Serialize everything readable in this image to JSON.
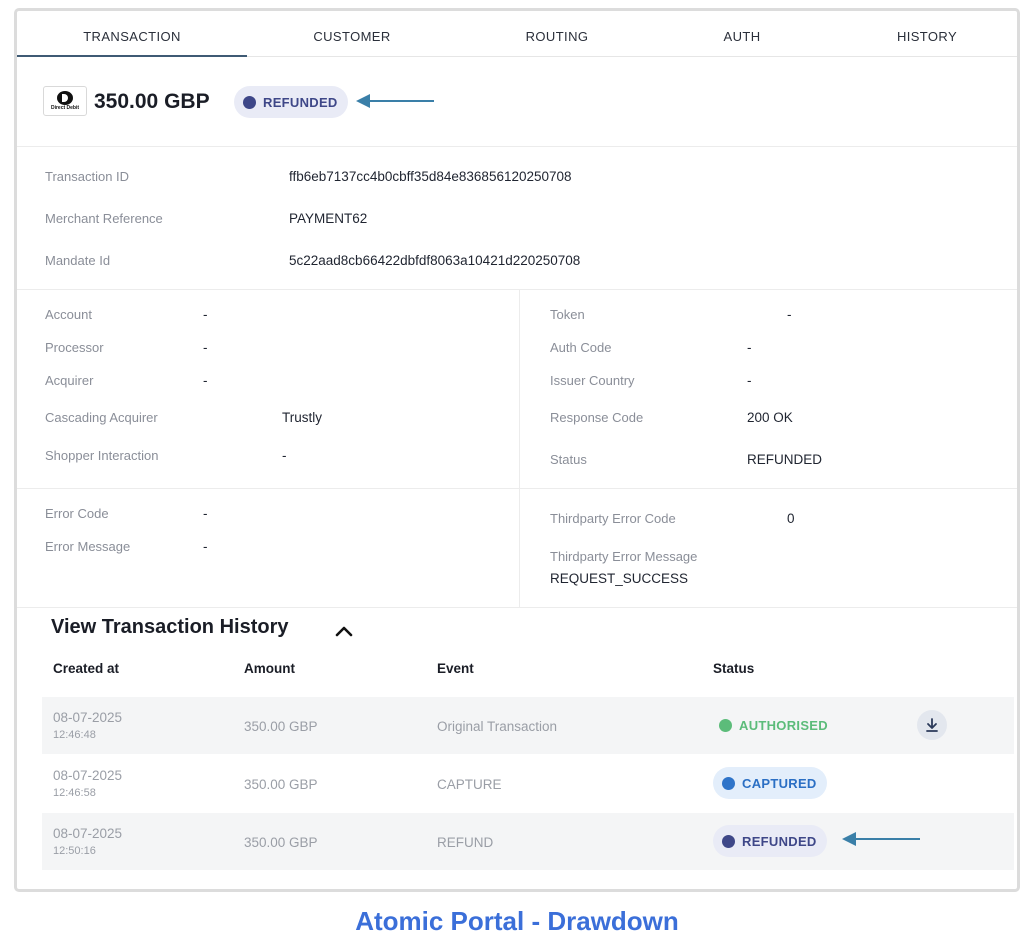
{
  "tabs": [
    "TRANSACTION",
    "CUSTOMER",
    "ROUTING",
    "AUTH",
    "HISTORY"
  ],
  "header": {
    "logo_text": "Direct Debit",
    "amount": "350.00 GBP",
    "status": "REFUNDED"
  },
  "ids": {
    "transaction_id_label": "Transaction ID",
    "transaction_id": "ffb6eb7137cc4b0cbff35d84e836856120250708",
    "merchant_ref_label": "Merchant Reference",
    "merchant_ref": "PAYMENT62",
    "mandate_id_label": "Mandate Id",
    "mandate_id": "5c22aad8cb66422dbfdf8063a10421d220250708"
  },
  "details_left": [
    {
      "label": "Account",
      "value": "-"
    },
    {
      "label": "Processor",
      "value": "-"
    },
    {
      "label": "Acquirer",
      "value": "-"
    },
    {
      "label": "Cascading Acquirer",
      "value": "Trustly"
    },
    {
      "label": "Shopper Interaction",
      "value": "-"
    }
  ],
  "details_right": [
    {
      "label": "Token",
      "value": "-"
    },
    {
      "label": "Auth Code",
      "value": "-"
    },
    {
      "label": "Issuer Country",
      "value": "-"
    },
    {
      "label": "Response Code",
      "value": "200 OK"
    },
    {
      "label": "Status",
      "value": "REFUNDED"
    }
  ],
  "errors": {
    "error_code_label": "Error Code",
    "error_code": "-",
    "error_message_label": "Error Message",
    "error_message": "-",
    "tp_error_code_label": "Thirdparty Error Code",
    "tp_error_code": "0",
    "tp_error_message_label": "Thirdparty Error Message",
    "tp_error_message": "REQUEST_SUCCESS"
  },
  "history": {
    "title": "View Transaction History",
    "columns": [
      "Created at",
      "Amount",
      "Event",
      "Status"
    ],
    "rows": [
      {
        "date": "08-07-2025",
        "time": "12:46:48",
        "amount": "350.00 GBP",
        "event": "Original Transaction",
        "status": "AUTHORISED"
      },
      {
        "date": "08-07-2025",
        "time": "12:46:58",
        "amount": "350.00 GBP",
        "event": "CAPTURE",
        "status": "CAPTURED"
      },
      {
        "date": "08-07-2025",
        "time": "12:50:16",
        "amount": "350.00 GBP",
        "event": "REFUND",
        "status": "REFUNDED"
      }
    ]
  },
  "caption": "Atomic Portal - Drawdown",
  "colors": {
    "refunded": "#3e4788",
    "captured": "#2f74c9",
    "authorised": "#5cbc7a",
    "arrow": "#3a7fa8",
    "caption": "#3b6fd9"
  },
  "icons": [
    "direct-debit-logo",
    "chevron-up-icon",
    "download-icon",
    "arrow-pointer-icon"
  ]
}
